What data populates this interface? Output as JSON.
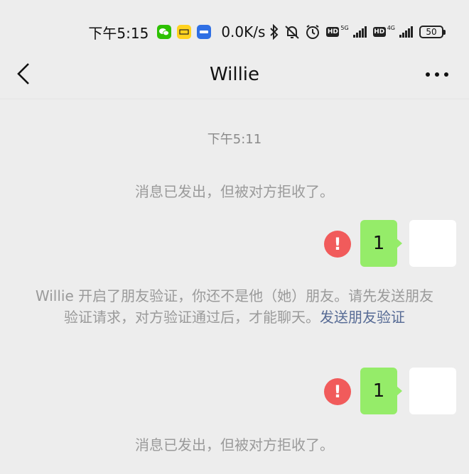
{
  "status_bar": {
    "time": "下午5:15",
    "network_speed": "0.0K/s",
    "network_1": "5G",
    "network_2": "4G",
    "hd": "HD",
    "battery": "50",
    "app_icons": [
      {
        "name": "wechat-app-icon",
        "color": "#2dc100"
      },
      {
        "name": "yellow-app-icon",
        "color": "#ffd21f"
      },
      {
        "name": "blue-app-icon",
        "color": "#2f6fe4"
      }
    ]
  },
  "header": {
    "title": "Willie",
    "back_icon": "chevron-left-icon",
    "more_icon": "more-dots-icon"
  },
  "chat": {
    "timestamp": "下午5:11",
    "system_rejected_1": "消息已发出，但被对方拒收了。",
    "messages": [
      {
        "text": "1",
        "status": "failed"
      },
      {
        "text": "1",
        "status": "failed"
      }
    ],
    "error_glyph": "!",
    "verification_notice": "Willie 开启了朋友验证，你还不是他（她）朋友。请先发送朋友验证请求，对方验证通过后，才能聊天。",
    "verification_link": "发送朋友验证",
    "system_rejected_2": "消息已发出，但被对方拒收了。"
  },
  "colors": {
    "background": "#ededed",
    "bubble": "#95ec69",
    "error": "#f15b5b",
    "link": "#576b95"
  }
}
